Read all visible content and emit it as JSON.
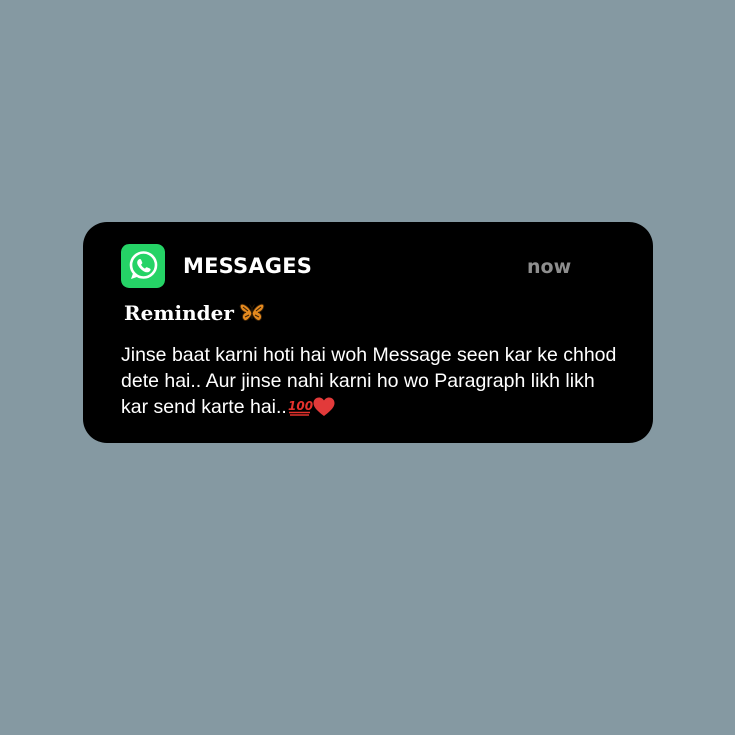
{
  "background_color": "#8599a2",
  "notification": {
    "app_icon": "whatsapp-icon",
    "app_name": "MESSAGES",
    "time": "now",
    "title": "Reminder",
    "title_icon": "butterfly-icon",
    "body": "Jinse baat karni hoti hai woh Message seen kar ke chhod dete hai.. Aur jinse nahi karni ho wo Paragraph likh likh kar send karte hai..",
    "body_icons": [
      "hundred-points-icon",
      "red-heart-icon"
    ]
  },
  "colors": {
    "card": "#000000",
    "text": "#ffffff",
    "muted": "#8e8e8e",
    "whatsapp_green": "#25d366"
  }
}
